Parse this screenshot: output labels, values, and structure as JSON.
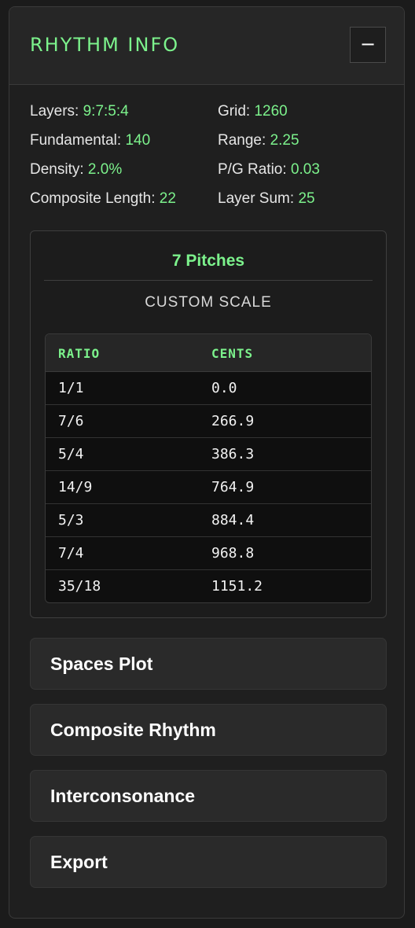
{
  "header": {
    "title": "RHYTHM INFO",
    "collapse_label": "−"
  },
  "info": {
    "layers": {
      "label": "Layers:",
      "value": "9:7:5:4"
    },
    "grid": {
      "label": "Grid:",
      "value": "1260"
    },
    "fundamental": {
      "label": "Fundamental:",
      "value": "140"
    },
    "range": {
      "label": "Range:",
      "value": "2.25"
    },
    "density": {
      "label": "Density:",
      "value": "2.0%"
    },
    "pg_ratio": {
      "label": "P/G Ratio:",
      "value": "0.03"
    },
    "composite_length": {
      "label": "Composite Length:",
      "value": "22"
    },
    "layer_sum": {
      "label": "Layer Sum:",
      "value": "25"
    }
  },
  "scale": {
    "pitch_count": "7 Pitches",
    "name": "CUSTOM SCALE",
    "columns": [
      "RATIO",
      "CENTS"
    ],
    "rows": [
      [
        "1/1",
        "0.0"
      ],
      [
        "7/6",
        "266.9"
      ],
      [
        "5/4",
        "386.3"
      ],
      [
        "14/9",
        "764.9"
      ],
      [
        "5/3",
        "884.4"
      ],
      [
        "7/4",
        "968.8"
      ],
      [
        "35/18",
        "1151.2"
      ]
    ]
  },
  "sections": [
    "Spaces Plot",
    "Composite Rhythm",
    "Interconsonance",
    "Export"
  ],
  "colors": {
    "accent": "#7cf28c",
    "background": "#1b1b1b",
    "panel": "#1f1f1f",
    "button": "#2a2a2a"
  }
}
